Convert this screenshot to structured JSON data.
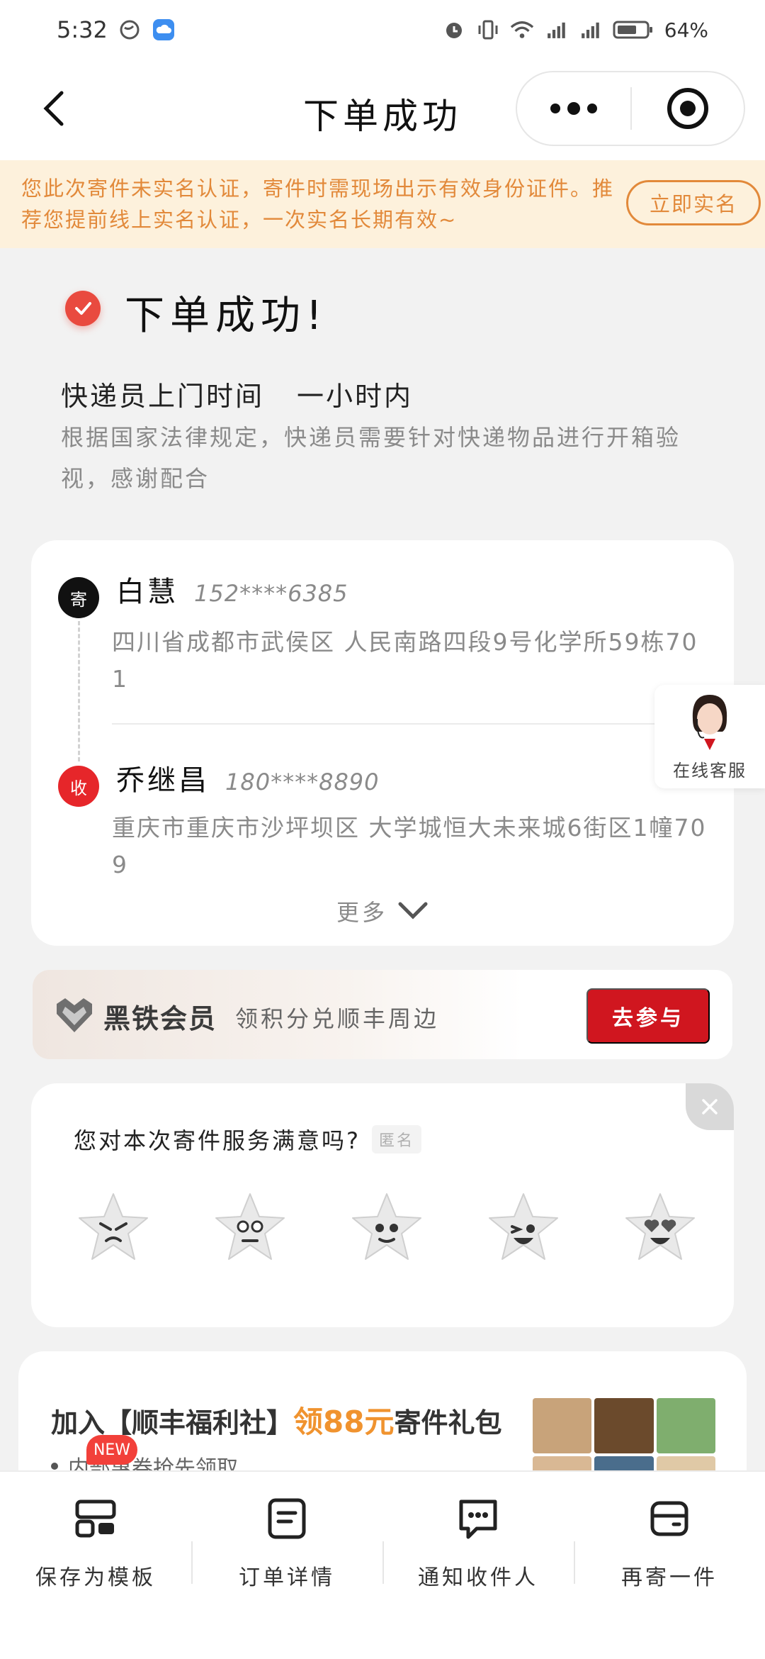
{
  "status_bar": {
    "time": "5:32",
    "battery": "64%"
  },
  "nav": {
    "title": "下单成功"
  },
  "notice": {
    "text": "您此次寄件未实名认证，寄件时需现场出示有效身份证件。推荐您提前线上实名认证，一次实名长期有效~",
    "button": "立即实名"
  },
  "success": {
    "title": "下单成功!",
    "pickup_label": "快递员上门时间",
    "pickup_value": "一小时内",
    "law_text": "根据国家法律规定，快递员需要针对快递物品进行开箱验视，感谢配合"
  },
  "sender": {
    "badge": "寄",
    "name": "白慧",
    "phone": "152****6385",
    "address": "四川省成都市武侯区  人民南路四段9号化学所59栋701"
  },
  "receiver": {
    "badge": "收",
    "name": "乔继昌",
    "phone": "180****8890",
    "address": "重庆市重庆市沙坪坝区  大学城恒大未来城6街区1幢709"
  },
  "more_label": "更多",
  "service": {
    "label": "在线客服"
  },
  "member": {
    "title": "黑铁会员",
    "desc": "领积分兑顺丰周边",
    "button": "去参与"
  },
  "rating": {
    "question": "您对本次寄件服务满意吗?",
    "anon": "匿名",
    "faces": [
      "angry-face",
      "worried-face",
      "neutral-face",
      "happy-face",
      "love-face"
    ]
  },
  "promo": {
    "title_prefix": "加入【顺丰福利社】",
    "title_highlight": "领88元",
    "title_suffix": "寄件礼包",
    "bullet": "内部惠券抢先领取",
    "new_tag": "NEW"
  },
  "tabs": [
    {
      "label": "保存为模板",
      "icon": "template-icon"
    },
    {
      "label": "订单详情",
      "icon": "order-detail-icon"
    },
    {
      "label": "通知收件人",
      "icon": "message-icon"
    },
    {
      "label": "再寄一件",
      "icon": "card-icon"
    }
  ],
  "colors": {
    "accent_red": "#d0161f",
    "notice_orange": "#e2893a",
    "success_red": "#e94a3f"
  }
}
